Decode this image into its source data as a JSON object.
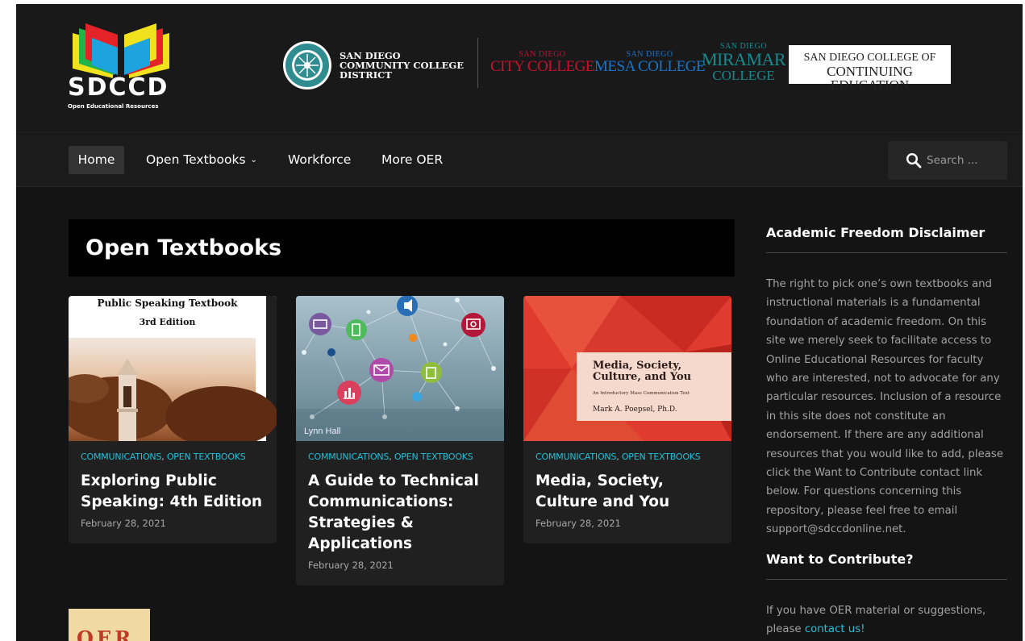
{
  "header": {
    "logo_word": "SDCCD",
    "logo_sub": "Open Educational Resources",
    "district_name": "SAN DIEGO COMMUNITY COLLEGE DISTRICT",
    "colleges": {
      "city_small": "SAN DIEGO",
      "city_big": "CITY COLLEGE",
      "mesa_small": "SAN DIEGO",
      "mesa_big": "MESA COLLEGE",
      "miramar_small": "SAN DIEGO",
      "miramar_big": "MIRAMAR",
      "miramar_big2": "COLLEGE",
      "continuing_l1": "SAN DIEGO COLLEGE OF",
      "continuing_l2": "CONTINUING EDUCATION"
    }
  },
  "nav": {
    "items": [
      {
        "label": "Home"
      },
      {
        "label": "Open Textbooks"
      },
      {
        "label": "Workforce"
      },
      {
        "label": "More OER"
      }
    ],
    "search_placeholder": "Search ..."
  },
  "main": {
    "heading": "Open Textbooks",
    "cards": [
      {
        "cat1": "COMMUNICATIONS",
        "cat2": "OPEN TEXTBOOKS",
        "title": "Exploring Public Speaking: 4th Edition",
        "date": "February 28, 2021",
        "cover_line1": "Public Speaking Textbook",
        "cover_line2": "3rd Edition"
      },
      {
        "cat1": "COMMUNICATIONS",
        "cat2": "OPEN TEXTBOOKS",
        "title": "A Guide to Technical Communications: Strategies & Applications",
        "date": "February 28, 2021",
        "cover_author": "Lynn Hall"
      },
      {
        "cat1": "COMMUNICATIONS",
        "cat2": "OPEN TEXTBOOKS",
        "title": "Media, Society, Culture and You",
        "date": "February 28, 2021",
        "cover_title": "Media, Society, Culture, and You",
        "cover_subtitle": "An Introductory Mass Communication Text",
        "cover_author": "Mark A. Poepsel, Ph.D."
      }
    ],
    "partial_thumb_text": "OER"
  },
  "sidebar": {
    "disclaimer_title": "Academic Freedom Disclaimer",
    "disclaimer_text": "The right to pick one’s own textbooks and instructional materials is a fundamental foundation of academic freedom. On this site we merely seek to facilitate access to Online Educational Resources for faculty who are interested, not to advocate for any particular resources. Inclusion of a resource in this site does not constitute an endorsement. If there are any additional resources that you would like to add, please click the Want to Contribute contact link below. For questions concerning this repository, please feel free to email support@sdccdonline.net.",
    "contribute_title": "Want to Contribute?",
    "contribute_text": "If you have OER material or suggestions, please",
    "contact_link": "contact us!"
  },
  "colors": {
    "page_bg": "#141414",
    "accent": "#1ec0d8",
    "city_red": "#c8102e",
    "mesa_blue": "#1a74c9",
    "miramar_teal": "#178a8e"
  },
  "icons": [
    "search-icon",
    "chevron-down-icon"
  ]
}
